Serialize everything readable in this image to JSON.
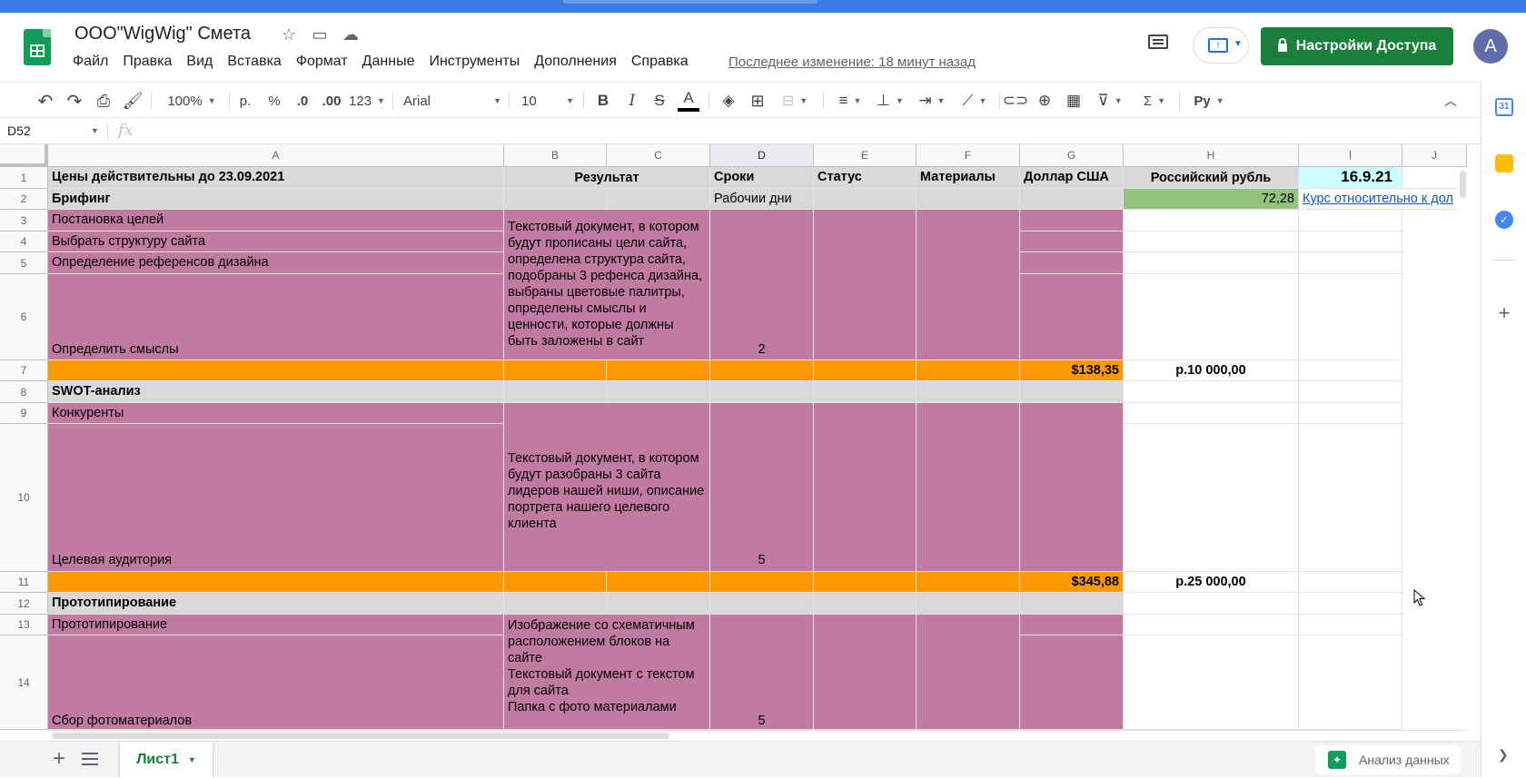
{
  "header": {
    "doc_title": "ООО\"WigWig\" Смета",
    "menu": [
      "Файл",
      "Правка",
      "Вид",
      "Вставка",
      "Формат",
      "Данные",
      "Инструменты",
      "Дополнения",
      "Справка"
    ],
    "last_edit": "Последнее изменение: 18 минут назад",
    "share_label": "Настройки Доступа",
    "avatar_letter": "A"
  },
  "toolbar": {
    "zoom": "100%",
    "currency": "р.",
    "percent": "%",
    "decimal_dec": ".0",
    "decimal_inc": ".00",
    "more_formats": "123",
    "font": "Arial",
    "font_size": "10",
    "bold": "B",
    "italic": "I",
    "strike": "S",
    "text_color": "A",
    "sum": "Σ",
    "script": "Py"
  },
  "formula_bar": {
    "cell_ref": "D52",
    "fx": "fx"
  },
  "sheet": {
    "columns": [
      "A",
      "B",
      "C",
      "D",
      "E",
      "F",
      "G",
      "H",
      "I",
      "J"
    ],
    "rows": [
      {
        "num": "1",
        "a": "Цены действительны до 23.09.2021",
        "bc": "Результат",
        "d": "Сроки",
        "e": "Статус",
        "f": "Материалы",
        "g": "Доллар США",
        "h": "Российский рубль",
        "i": "16.9.21"
      },
      {
        "num": "2",
        "a": "Брифинг",
        "d": "Рабочии дни",
        "h": "72,28",
        "i": "Курс относительно к дол"
      },
      {
        "num": "3",
        "a": "Постановка целей"
      },
      {
        "num": "4",
        "a": "Выбрать структуру сайта"
      },
      {
        "num": "5",
        "a": "Определение референсов дизайна"
      },
      {
        "num": "6",
        "a": "Определить смыслы",
        "d": "2"
      },
      {
        "num": "7",
        "g": "$138,35",
        "h": "р.10 000,00"
      },
      {
        "num": "8",
        "a": "SWOT-анализ"
      },
      {
        "num": "9",
        "a": "Конкуренты"
      },
      {
        "num": "10"
      },
      {
        "num": "11",
        "a": "Целевая аудитория",
        "d": "5",
        "g": "$345,88",
        "h": "р.25 000,00"
      },
      {
        "num": "12",
        "a": "Прототипирование"
      },
      {
        "num": "13",
        "a": "Прототипирование"
      },
      {
        "num": "14",
        "a": "Сбор фотоматериалов",
        "d": "5"
      }
    ],
    "merged_b_briefing": "Текстовый документ,  в котором будут прописаны цели сайта, определена структура сайта, подобраны 3 рефенса дизайна, выбраны цветовые палитры, определены смыслы и ценности, которые должны быть заложены в сайт",
    "merged_b_swot": "Текстовый документ, в котором будут разобраны 3 сайта лидеров нашей ниши, описание портрета нашего целевого клиента",
    "merged_b_proto": "Изображение со схематичным расположением блоков на сайте\nТекстовый документ с текстом для сайта\nПапка с фото материалами"
  },
  "tabs": {
    "sheet_name": "Лист1",
    "explore_label": "Анализ данных"
  },
  "colors": {
    "mauve": "#c27ba0",
    "orange": "#ff9900",
    "gray": "#d9d9d9",
    "green": "#93c47d",
    "cyan": "#ccffff",
    "share_green": "#188038"
  }
}
